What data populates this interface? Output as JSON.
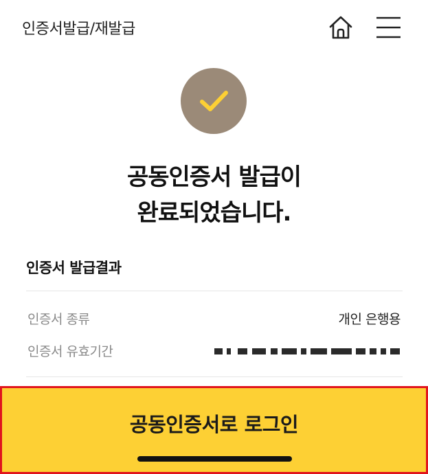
{
  "header": {
    "title": "인증서발급/재발급",
    "home_icon": "home-icon",
    "menu_icon": "hamburger-menu-icon"
  },
  "status": {
    "icon": "check-icon",
    "circle_color": "#9b8a78",
    "check_color": "#fdd034",
    "title_line1": "공동인증서 발급이",
    "title_line2": "완료되었습니다."
  },
  "result": {
    "section_title": "인증서 발급결과",
    "rows": [
      {
        "label": "인증서 종류",
        "value": "개인 은행용"
      },
      {
        "label": "인증서 유효기간",
        "value": ""
      }
    ]
  },
  "footer": {
    "login_label": "공동인증서로 로그인",
    "button_color": "#fdd034",
    "highlight_border": "#e0141d"
  }
}
